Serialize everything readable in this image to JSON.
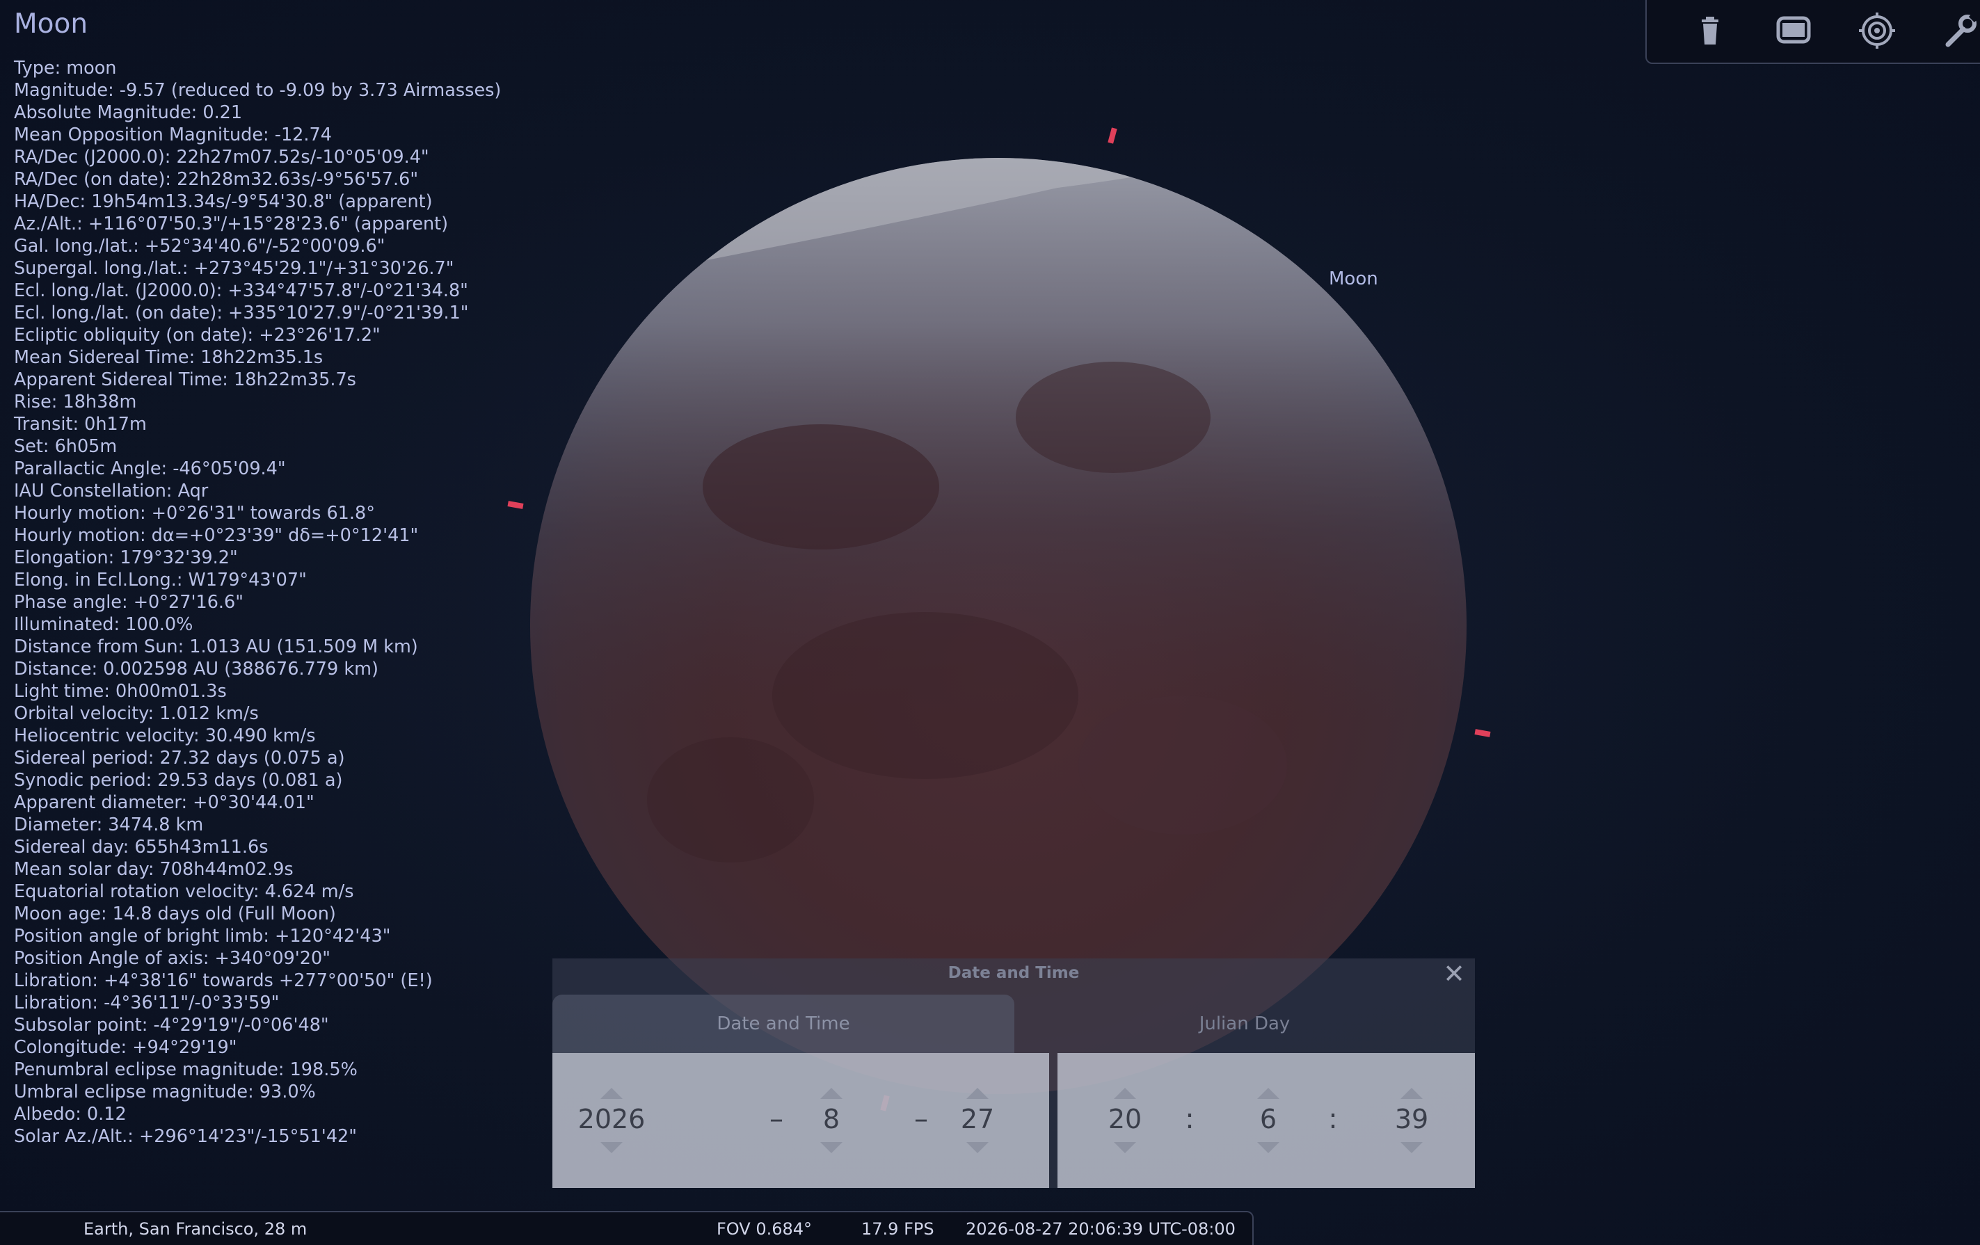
{
  "object": {
    "name": "Moon",
    "sky_label": "Moon",
    "info_lines": [
      "Type: moon",
      "Magnitude: -9.57 (reduced to -9.09 by 3.73 Airmasses)",
      "Absolute Magnitude: 0.21",
      "Mean Opposition Magnitude: -12.74",
      "RA/Dec (J2000.0): 22h27m07.52s/-10°05'09.4\"",
      "RA/Dec (on date): 22h28m32.63s/-9°56'57.6\"",
      "HA/Dec: 19h54m13.34s/-9°54'30.8\" (apparent)",
      "Az./Alt.: +116°07'50.3\"/+15°28'23.6\" (apparent)",
      "Gal. long./lat.: +52°34'40.6\"/-52°00'09.6\"",
      "Supergal. long./lat.: +273°45'29.1\"/+31°30'26.7\"",
      "Ecl. long./lat. (J2000.0): +334°47'57.8\"/-0°21'34.8\"",
      "Ecl. long./lat. (on date): +335°10'27.9\"/-0°21'39.1\"",
      "Ecliptic obliquity (on date): +23°26'17.2\"",
      "Mean Sidereal Time: 18h22m35.1s",
      "Apparent Sidereal Time: 18h22m35.7s",
      "Rise: 18h38m",
      "Transit: 0h17m",
      "Set: 6h05m",
      "Parallactic Angle: -46°05'09.4\"",
      "IAU Constellation: Aqr",
      "Hourly motion: +0°26'31\" towards 61.8°",
      "Hourly motion: dα=+0°23'39\" dδ=+0°12'41\"",
      "Elongation: 179°32'39.2\"",
      "Elong. in Ecl.Long.: W179°43'07\"",
      "Phase angle: +0°27'16.6\"",
      "Illuminated: 100.0%",
      "Distance from Sun: 1.013 AU (151.509 M km)",
      "Distance: 0.002598 AU (388676.779 km)",
      "Light time: 0h00m01.3s",
      "Orbital velocity: 1.012 km/s",
      "Heliocentric velocity: 30.490 km/s",
      "Sidereal period: 27.32 days (0.075 a)",
      "Synodic period: 29.53 days (0.081 a)",
      "Apparent diameter: +0°30'44.01\"",
      "Diameter: 3474.8 km",
      "Sidereal day: 655h43m11.6s",
      "Mean solar day: 708h44m02.9s",
      "Equatorial rotation velocity: 4.624 m/s",
      "Moon age: 14.8 days old (Full Moon)",
      "Position angle of bright limb: +120°42'43\"",
      "Position Angle of axis: +340°09'20\"",
      "Libration: +4°38'16\" towards +277°00'50\" (E!)",
      "Libration: -4°36'11\"/-0°33'59\"",
      "Subsolar point: -4°29'19\"/-0°06'48\"",
      "Colongitude: +94°29'19\"",
      "Penumbral eclipse magnitude: 198.5%",
      "Umbral eclipse magnitude: 93.0%",
      "Albedo: 0.12",
      "Solar Az./Alt.: +296°14'23\"/-15°51'42\""
    ]
  },
  "toolbar": {
    "icons": [
      "trash-can-icon",
      "screen-icon",
      "target-icon",
      "wrench-icon"
    ]
  },
  "dialog": {
    "title": "Date and Time",
    "close_label": "✕",
    "tabs": [
      {
        "label": "Date and Time",
        "active": true
      },
      {
        "label": "Julian Day",
        "active": false
      }
    ],
    "date": {
      "year": "2026",
      "month": "8",
      "day": "27",
      "sep": "–"
    },
    "time": {
      "hour": "20",
      "minute": "6",
      "second": "39",
      "sep": ":"
    }
  },
  "status": {
    "location": "Earth, San Francisco, 28 m",
    "fov": "FOV 0.684°",
    "fps": "17.9 FPS",
    "datetime": "2026-08-27 20:06:39 UTC-08:00"
  },
  "colors": {
    "sky": "#0d1424",
    "text": "#b9c1e6",
    "marker": "#e0405a"
  }
}
